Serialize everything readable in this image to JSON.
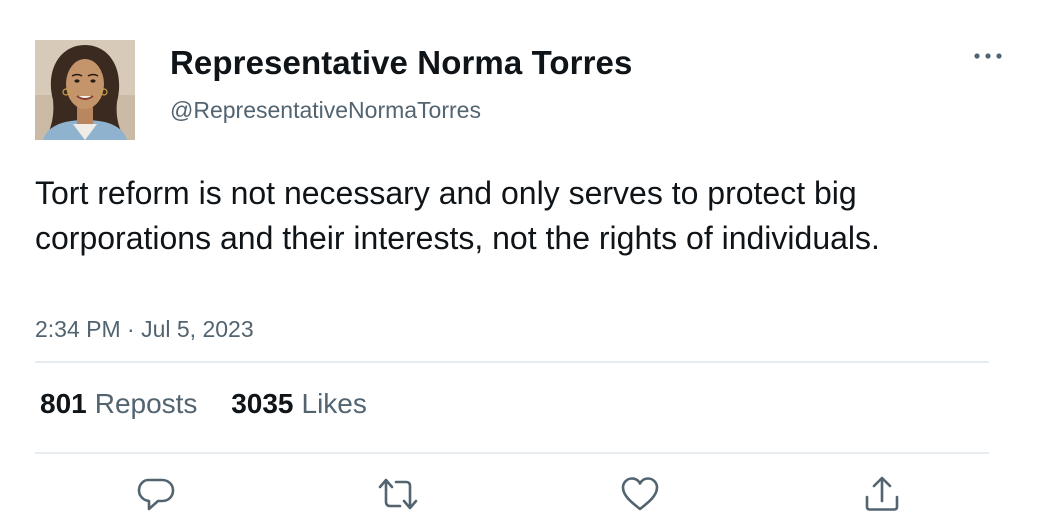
{
  "tweet": {
    "author": {
      "display_name": "Representative Norma Torres",
      "handle": "@RepresentativeNormaTorres"
    },
    "text": "Tort reform is not necessary and only serves to protect big corporations and their interests, not the rights of individuals.",
    "timestamp": "2:34 PM · Jul 5, 2023",
    "stats": {
      "reposts_count": "801",
      "reposts_label": "Reposts",
      "likes_count": "3035",
      "likes_label": "Likes"
    }
  },
  "icons": {
    "more": "more-horizontal-icon",
    "reply": "reply-icon",
    "repost": "repost-icon",
    "like": "heart-icon",
    "share": "share-icon"
  },
  "colors": {
    "text_primary": "#0f1419",
    "text_secondary": "#536471",
    "divider": "#e6ecf0"
  }
}
